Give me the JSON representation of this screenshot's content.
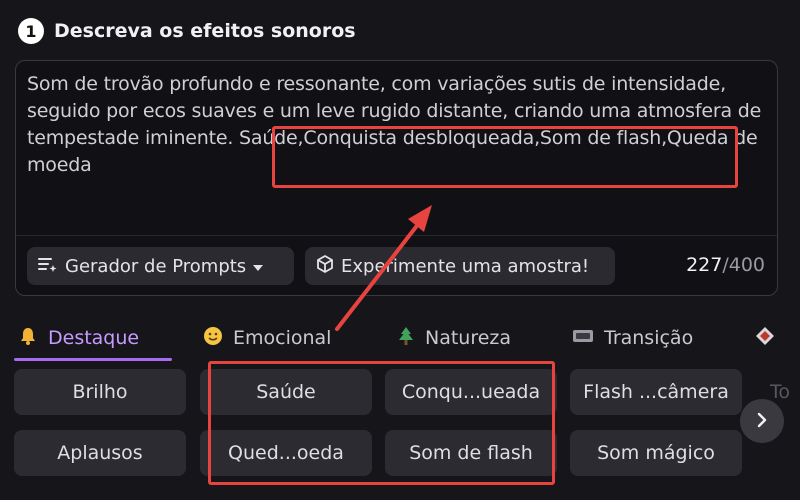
{
  "section": {
    "step": "1",
    "title": "Descreva os efeitos sonoros"
  },
  "prompt": {
    "text": "Som de trovão profundo e ressonante, com variações sutis de intensidade, seguido por ecos suaves e um leve rugido distante, criando uma atmosfera de tempestade iminente. Saúde,Conquista desbloqueada,Som de flash,Queda de moeda"
  },
  "toolbar": {
    "generator_label": "Gerador de Prompts",
    "sample_label": "Experimente uma amostra!"
  },
  "counter": {
    "current": "227",
    "max": "/400"
  },
  "tabs": [
    {
      "label": "Destaque",
      "icon": "bell-icon",
      "active": true
    },
    {
      "label": "Emocional",
      "icon": "smiley-icon"
    },
    {
      "label": "Natureza",
      "icon": "tree-icon"
    },
    {
      "label": "Transição",
      "icon": "transition-icon"
    },
    {
      "label": "",
      "icon": "diamond-icon"
    }
  ],
  "chips": {
    "row1": [
      "Brilho",
      "Saúde",
      "Conqu...ueada",
      "Flash ...câmera"
    ],
    "row2": [
      "Aplausos",
      "Qued...oeda",
      "Som de flash",
      "Som mágico"
    ],
    "overflow": "To"
  },
  "colors": {
    "accent": "#a56cf3",
    "annotation": "#e8443f",
    "background": "#161519"
  }
}
